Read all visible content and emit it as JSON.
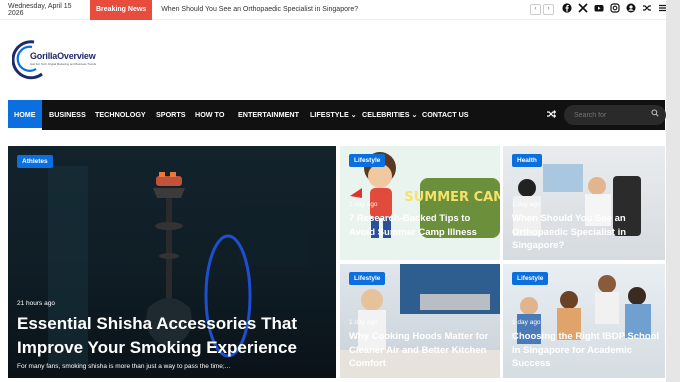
{
  "topbar": {
    "date": "Wednesday, April 15 2026",
    "breaking_label": "Breaking News",
    "ticker_text": "When Should You See an Orthopaedic Specialist in Singapore?",
    "prev_arrow": "‹",
    "next_arrow": "›"
  },
  "logo": {
    "name_part1": "Gorilla",
    "name_part2": "Overview",
    "tagline": "Hub For Tech, Digital Marketing and Business Trends"
  },
  "nav": {
    "items": [
      {
        "label": "HOME"
      },
      {
        "label": "BUSINESS"
      },
      {
        "label": "TECHNOLOGY"
      },
      {
        "label": "SPORTS"
      },
      {
        "label": "HOW TO"
      },
      {
        "label": "ENTERTAINMENT"
      },
      {
        "label": "LIFESTYLE ⌄"
      },
      {
        "label": "CELEBRITIES ⌄"
      },
      {
        "label": "CONTACT US"
      }
    ],
    "search_placeholder": "Search for"
  },
  "cards": [
    {
      "category": "Athletes",
      "time": "21 hours ago",
      "title": "Essential Shisha Accessories That Improve Your Smoking Experience",
      "excerpt": "For many fans, smoking shisha is more than just a way to pass the time;..."
    },
    {
      "category": "Lifestyle",
      "time": "1 day ago",
      "title": "7 Research-Backed Tips to Avoid Summer Camp Illness",
      "art_text": "SUMMER CAMP"
    },
    {
      "category": "Health",
      "time": "1 day ago",
      "title": "When Should You See an Orthopaedic Specialist in Singapore?"
    },
    {
      "category": "Lifestyle",
      "time": "1 day ago",
      "title": "Why Cooking Hoods Matter for Cleaner Air and Better Kitchen Comfort"
    },
    {
      "category": "Lifestyle",
      "time": "1 day ago",
      "title": "Choosing the Right IBDP School in Singapore for Academic Success"
    }
  ],
  "colors": {
    "accent": "#0b6fe0",
    "breaking": "#e74c3c",
    "nav_bg": "#111111"
  }
}
